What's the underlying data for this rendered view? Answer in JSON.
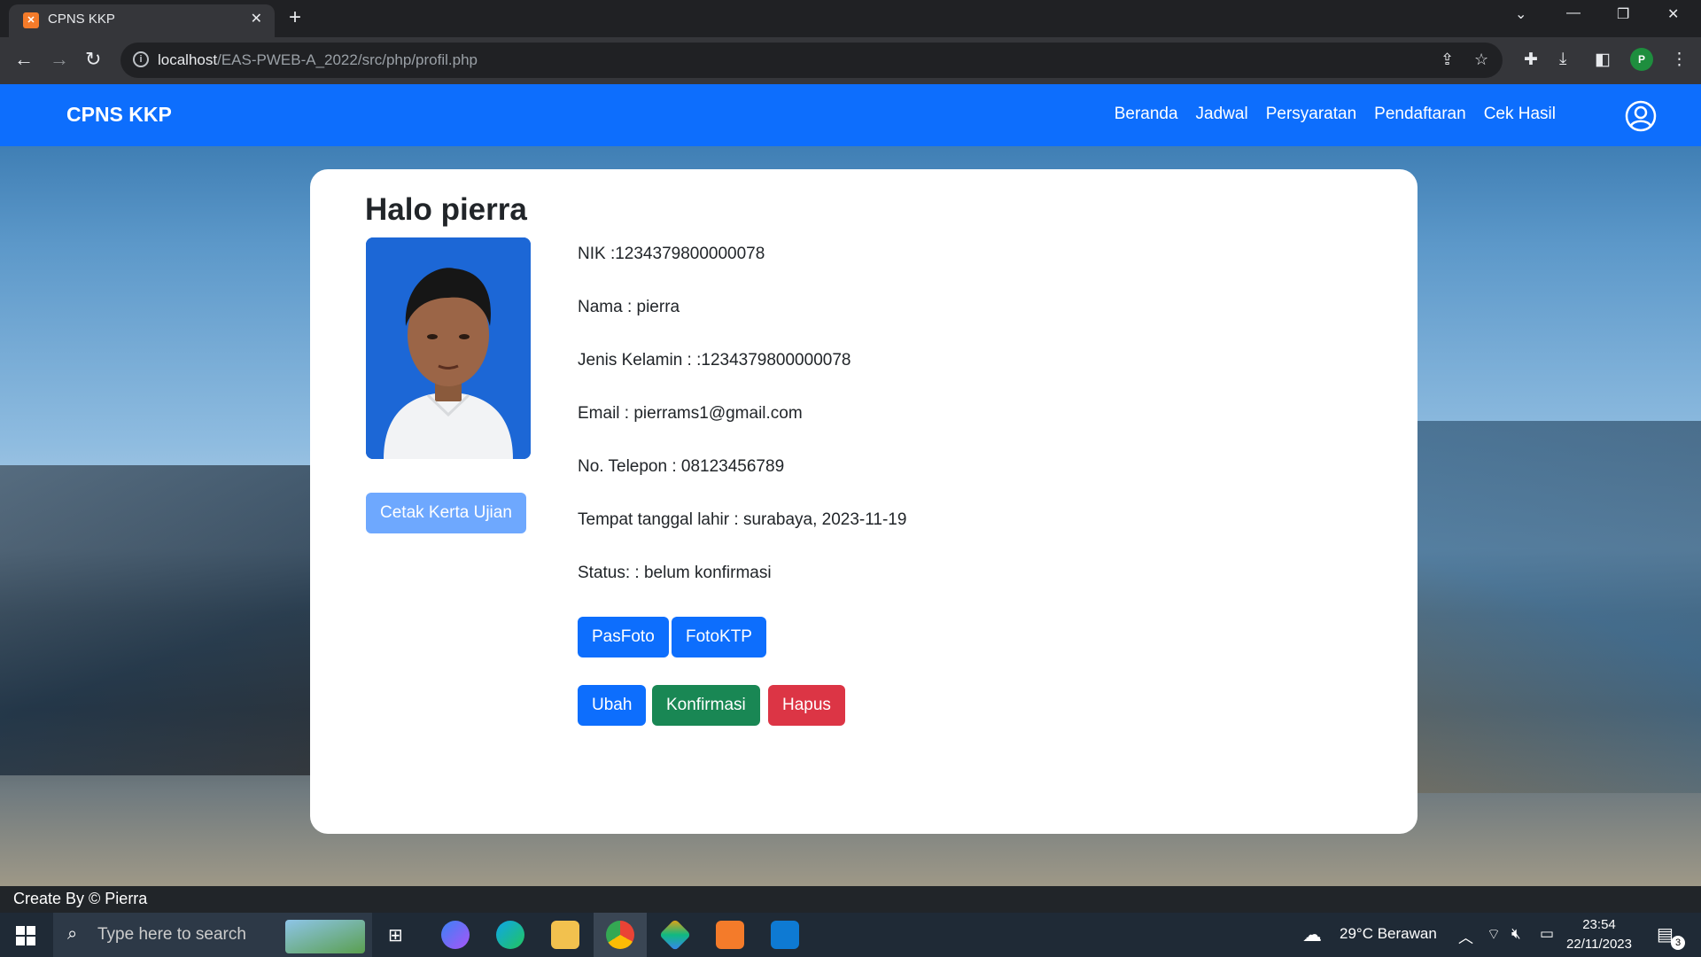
{
  "browser": {
    "tab_title": "CPNS KKP",
    "url_host": "localhost",
    "url_path": "/EAS-PWEB-A_2022/src/php/profil.php",
    "profile_initial": "P"
  },
  "navbar": {
    "brand": "CPNS KKP",
    "links": [
      "Beranda",
      "Jadwal",
      "Persyaratan",
      "Pendaftaran",
      "Cek Hasil"
    ]
  },
  "profile": {
    "greeting": "Halo pierra",
    "print_button": "Cetak Kerta Ujian",
    "fields": [
      "NIK :1234379800000078",
      "Nama : pierra",
      "Jenis Kelamin : :1234379800000078",
      "Email : pierrams1@gmail.com",
      "No. Telepon : 08123456789",
      "Tempat tanggal lahir : surabaya, 2023-11-19",
      "Status: : belum konfirmasi"
    ],
    "doc_buttons": [
      "PasFoto",
      "FotoKTP"
    ],
    "action_buttons": [
      "Ubah",
      "Konfirmasi",
      "Hapus"
    ]
  },
  "footer": {
    "text": "Create By © Pierra"
  },
  "taskbar": {
    "search_placeholder": "Type here to search",
    "weather": "29°C  Berawan",
    "time": "23:54",
    "date": "22/11/2023",
    "notification_count": "3"
  },
  "colors": {
    "primary": "#0d6efd",
    "success": "#198754",
    "danger": "#dc3545",
    "primary_light": "#6ea8fe"
  }
}
